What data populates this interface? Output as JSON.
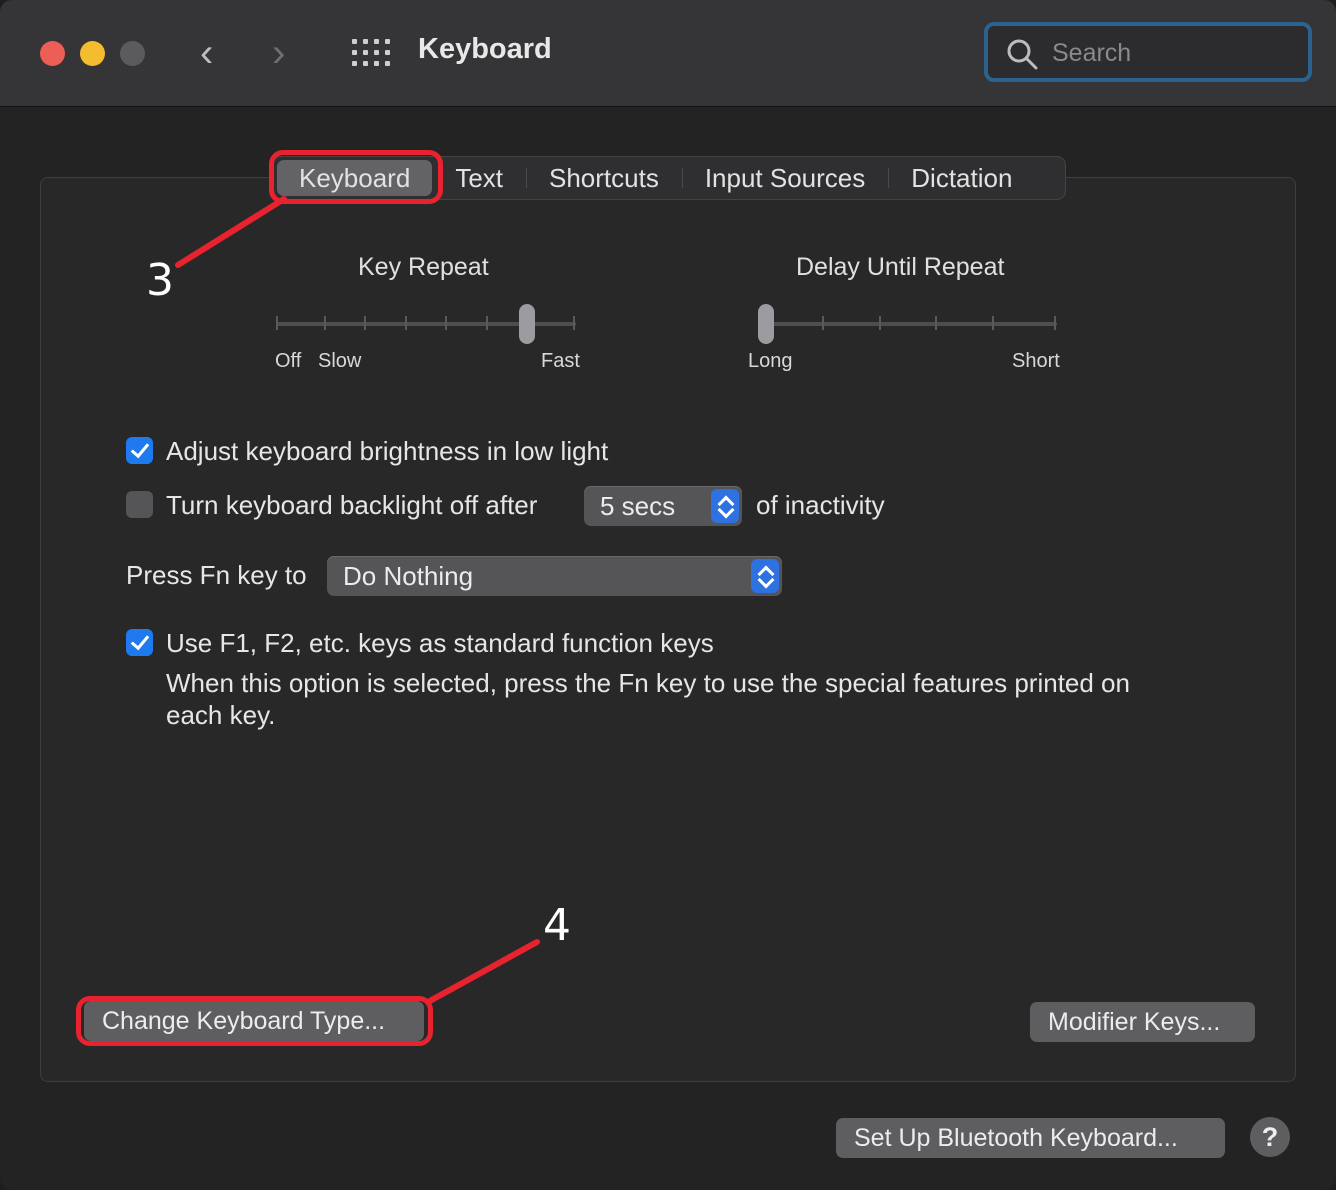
{
  "window": {
    "title": "Keyboard",
    "search_placeholder": "Search"
  },
  "tabs": [
    {
      "label": "Keyboard",
      "selected": true
    },
    {
      "label": "Text",
      "selected": false
    },
    {
      "label": "Shortcuts",
      "selected": false
    },
    {
      "label": "Input Sources",
      "selected": false
    },
    {
      "label": "Dictation",
      "selected": false
    }
  ],
  "key_repeat": {
    "title": "Key Repeat",
    "label_off": "Off",
    "label_slow": "Slow",
    "label_fast": "Fast",
    "stops": 8,
    "selected_stop": 7
  },
  "delay_until_repeat": {
    "title": "Delay Until Repeat",
    "label_long": "Long",
    "label_short": "Short",
    "stops": 6,
    "selected_stop": 1
  },
  "options": {
    "adjust_brightness": {
      "label": "Adjust keyboard brightness in low light",
      "checked": true
    },
    "backlight_off": {
      "label": "Turn keyboard backlight off after",
      "checked": false,
      "value": "5 secs",
      "suffix": "of inactivity"
    },
    "fn_key": {
      "label": "Press Fn key to",
      "value": "Do Nothing"
    },
    "function_keys": {
      "label": "Use F1, F2, etc. keys as standard function keys",
      "checked": true,
      "description_line1": "When this option is selected, press the Fn key to use the special features printed on",
      "description_line2": "each key."
    }
  },
  "buttons": {
    "change_keyboard_type": "Change Keyboard Type...",
    "modifier_keys": "Modifier Keys...",
    "bluetooth_keyboard": "Set Up Bluetooth Keyboard...",
    "help": "?"
  },
  "annotations": {
    "step3": "3",
    "step4": "4",
    "highlight_color": "#e8232f"
  }
}
